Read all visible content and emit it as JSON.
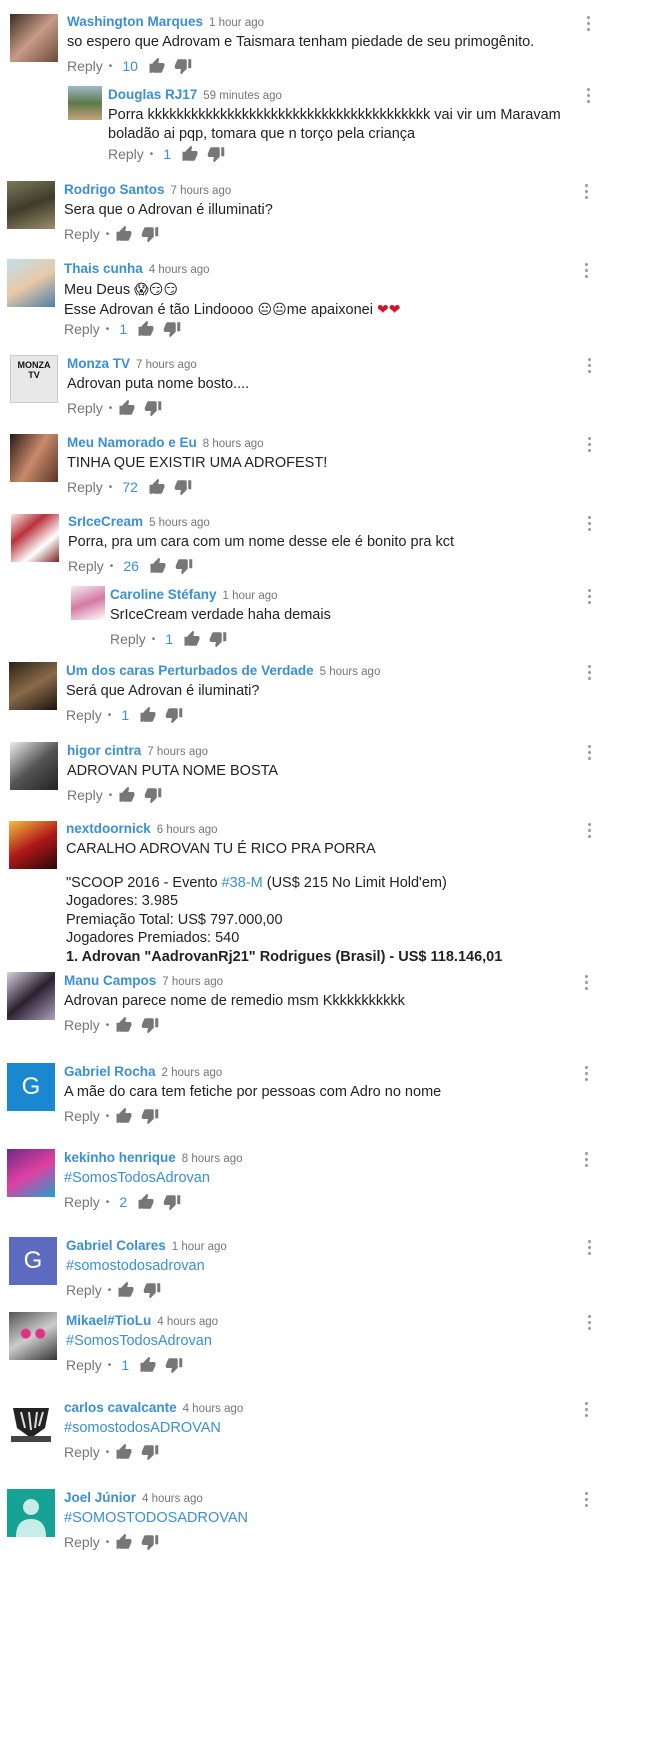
{
  "ui": {
    "reply_label": "Reply",
    "separator": "•"
  },
  "comments": [
    {
      "author": "Washington Marques",
      "time": "1 hour ago",
      "text": "so espero que Adrovam e Taismara tenham piedade de seu primogênito.",
      "likes": "10",
      "avatar": "photo-woman-hair"
    },
    {
      "author": "Douglas RJ17",
      "time": "59 minutes ago",
      "text": "Porra kkkkkkkkkkkkkkkkkkkkkkkkkkkkkkkkkkkkkkk vai vir um Maravam boladão ai pqp, tomara que n torço pela criança",
      "likes": "1",
      "avatar": "photo-outdoor",
      "reply": true
    },
    {
      "author": "Rodrigo Santos",
      "time": "7 hours ago",
      "text": "Sera que o Adrovan é illuminati?",
      "likes": "",
      "avatar": "photo-soldier"
    },
    {
      "author": "Thais cunha",
      "time": "4 hours ago",
      "text_line1": "Meu Deus",
      "text_line2": "Esse Adrovan é tão Lindoooo",
      "text_line2_after": "me apaixonei",
      "likes": "1",
      "avatar": "photo-woman-blue"
    },
    {
      "author": "Monza TV",
      "time": "7 hours ago",
      "text": "Adrovan puta nome bosto....",
      "likes": "",
      "avatar": "logo-monza-tv"
    },
    {
      "author": "Meu Namorado e Eu",
      "time": "8 hours ago",
      "text": "TINHA QUE EXISTIR UMA ADROFEST!",
      "likes": "72",
      "avatar": "photo-couple"
    },
    {
      "author": "SrIceCream",
      "time": "5 hours ago",
      "text": "Porra, pra um cara com um nome desse ele é bonito pra kct",
      "likes": "26",
      "avatar": "photo-icecream"
    },
    {
      "author": "Caroline Stéfany",
      "time": "1 hour ago",
      "text": "SrIceCream verdade haha demais",
      "likes": "1",
      "avatar": "photo-girl",
      "reply": true
    },
    {
      "author": "Um dos caras Perturbados de Verdade",
      "time": "5 hours ago",
      "text": "Será que Adrovan é iluminati?",
      "likes": "1",
      "avatar": "photo-man-suit"
    },
    {
      "author": "higor cintra",
      "time": "7 hours ago",
      "text": "ADROVAN PUTA NOME BOSTA",
      "likes": "",
      "avatar": "photo-man-hat"
    },
    {
      "author": "nextdoornick",
      "time": "6 hours ago",
      "text_l1": "CARALHO ADROVAN TU É RICO PRA PORRA",
      "text_l2a": "\"SCOOP 2016 - Evento ",
      "text_l2hash": "#38-M",
      "text_l2b": " (US$ 215 No Limit Hold'em)",
      "text_l3": "Jogadores: 3.985",
      "text_l4": "Premiação Total: US$ 797.000,00",
      "text_l5": "Jogadores Premiados: 540",
      "text_l6": "1. Adrovan \"AadrovanRj21\" Rodrigues (Brasil) - US$ 118.146,01",
      "avatar": "photo-flash"
    },
    {
      "author": "Manu Campos",
      "time": "7 hours ago",
      "text": "Adrovan parece nome de remedio msm Kkkkkkkkkkk",
      "likes": "",
      "avatar": "photo-woman-dark"
    },
    {
      "author": "Gabriel Rocha",
      "time": "2 hours ago",
      "text": "A mãe do cara tem fetiche por pessoas com Adro no nome",
      "likes": "",
      "avatar_letter": "G",
      "avatar_color": "#1a88d0"
    },
    {
      "author": "kekinho henrique",
      "time": "8 hours ago",
      "text": "#SomosTodosAdrovan",
      "likes": "2",
      "avatar": "photo-boy-cap"
    },
    {
      "author": "Gabriel Colares",
      "time": "1 hour ago",
      "text": "#somostodosadrovan",
      "likes": "",
      "avatar_letter": "G",
      "avatar_color": "#5c6bc0"
    },
    {
      "author": "Mikael#TioLu",
      "time": "4 hours ago",
      "text": "#SomosTodosAdrovan",
      "likes": "1",
      "avatar": "photo-cat-glasses"
    },
    {
      "author": "carlos cavalcante",
      "time": "4 hours ago",
      "text": "#somostodosADROVAN",
      "likes": "",
      "avatar": "logo-band"
    },
    {
      "author": "Joel Júnior",
      "time": "4 hours ago",
      "text": "#SOMOSTODOSADROVAN",
      "likes": "",
      "avatar": "default-person",
      "avatar_color": "#16a294"
    }
  ]
}
